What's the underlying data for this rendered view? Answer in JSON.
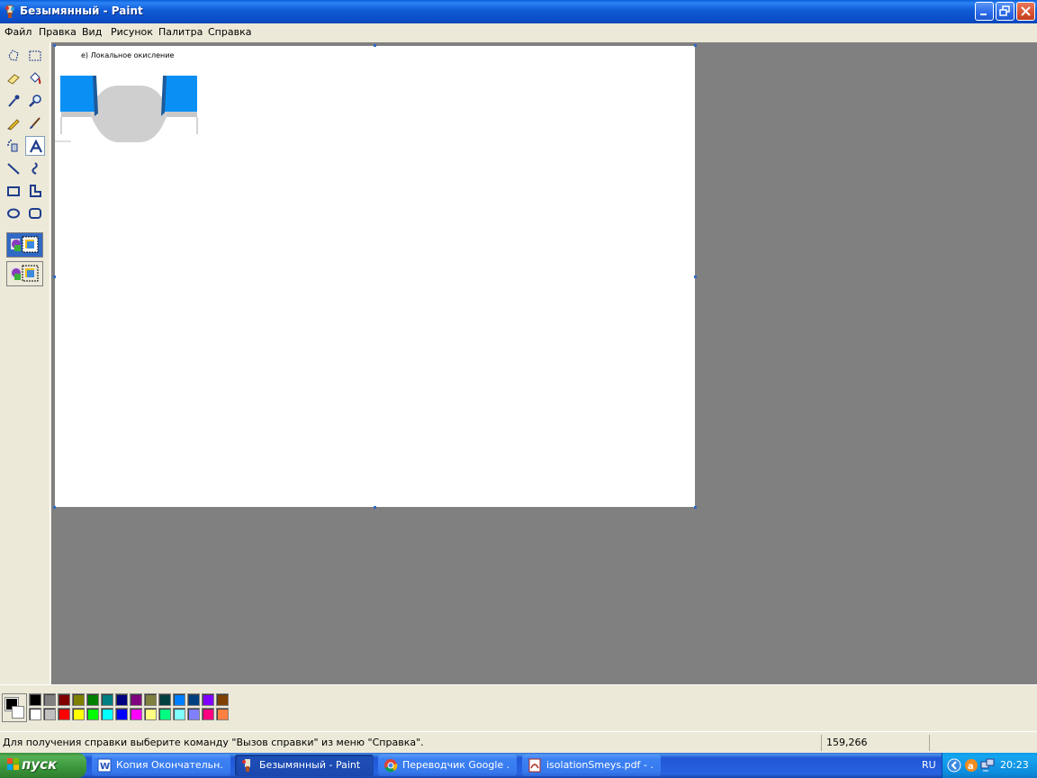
{
  "window": {
    "title": "Безымянный - Paint"
  },
  "menu": [
    "Файл",
    "Правка",
    "Вид",
    "Рисунок",
    "Палитра",
    "Справка"
  ],
  "canvas": {
    "caption": "е) Локальное окисление"
  },
  "tools": [
    "free-form-select-icon",
    "select-icon",
    "eraser-icon",
    "fill-icon",
    "pick-color-icon",
    "magnifier-icon",
    "pencil-icon",
    "brush-icon",
    "airbrush-icon",
    "text-icon",
    "line-icon",
    "curve-icon",
    "rectangle-icon",
    "polygon-icon",
    "ellipse-icon",
    "rounded-rectangle-icon"
  ],
  "palette": {
    "foreground": "#000000",
    "background": "#FFFFFF",
    "row1": [
      "#000000",
      "#808080",
      "#800000",
      "#808000",
      "#008000",
      "#008080",
      "#000080",
      "#800080",
      "#808040",
      "#004040",
      "#0080FF",
      "#004080",
      "#8000FF",
      "#804000"
    ],
    "row2": [
      "#FFFFFF",
      "#C0C0C0",
      "#FF0000",
      "#FFFF00",
      "#00FF00",
      "#00FFFF",
      "#0000FF",
      "#FF00FF",
      "#FFFF80",
      "#00FF80",
      "#80FFFF",
      "#8080FF",
      "#FF0080",
      "#FF8040"
    ]
  },
  "status": {
    "message": "Для получения справки выберите команду \"Вызов справки\" из меню \"Справка\".",
    "coords": "159,266"
  },
  "taskbar": {
    "start": "пуск",
    "tasks": [
      {
        "label": "Копия Окончательн...",
        "icon": "word-icon"
      },
      {
        "label": "Безымянный - Paint",
        "icon": "paint-icon"
      },
      {
        "label": "Переводчик Google ...",
        "icon": "chrome-icon"
      },
      {
        "label": "isolationSmeys.pdf - ...",
        "icon": "pdf-icon"
      }
    ],
    "lang": "RU",
    "clock": "20:23"
  }
}
